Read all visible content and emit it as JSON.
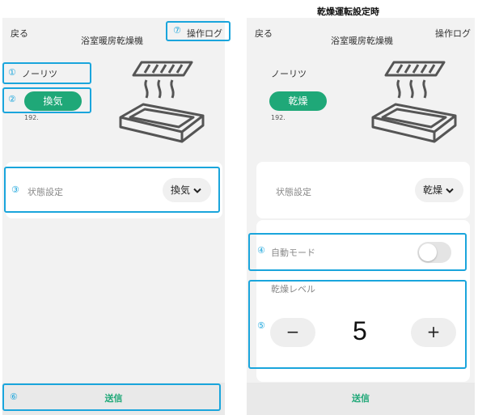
{
  "heading": "乾燥運転設定時",
  "left_screen": {
    "back": "戻る",
    "op_log": "操作ログ",
    "device_title": "浴室暖房乾燥機",
    "device_name": "ノーリツ",
    "mode_pill": "換気",
    "ip": "192.",
    "state_label": "状態設定",
    "state_value": "換気",
    "send": "送信"
  },
  "right_screen": {
    "back": "戻る",
    "op_log": "操作ログ",
    "device_title": "浴室暖房乾燥機",
    "device_name": "ノーリツ",
    "mode_pill": "乾燥",
    "ip": "192.",
    "state_label": "状態設定",
    "state_value": "乾燥",
    "auto_mode_label": "自動モード",
    "auto_mode_on": false,
    "level_label": "乾燥レベル",
    "level_value": "5",
    "minus": "−",
    "plus": "+",
    "send": "送信"
  },
  "annotations": {
    "n1": "①",
    "n2": "②",
    "n3": "③",
    "n4": "④",
    "n5": "⑤",
    "n6": "⑥",
    "n7": "⑦"
  },
  "colors": {
    "accent_green": "#1fa878",
    "highlight_blue": "#1aa5dc",
    "panel_bg": "#f2f2f2"
  },
  "icons": {
    "dryer": "bathroom-dryer-icon",
    "chevron": "chevron-down-icon"
  }
}
